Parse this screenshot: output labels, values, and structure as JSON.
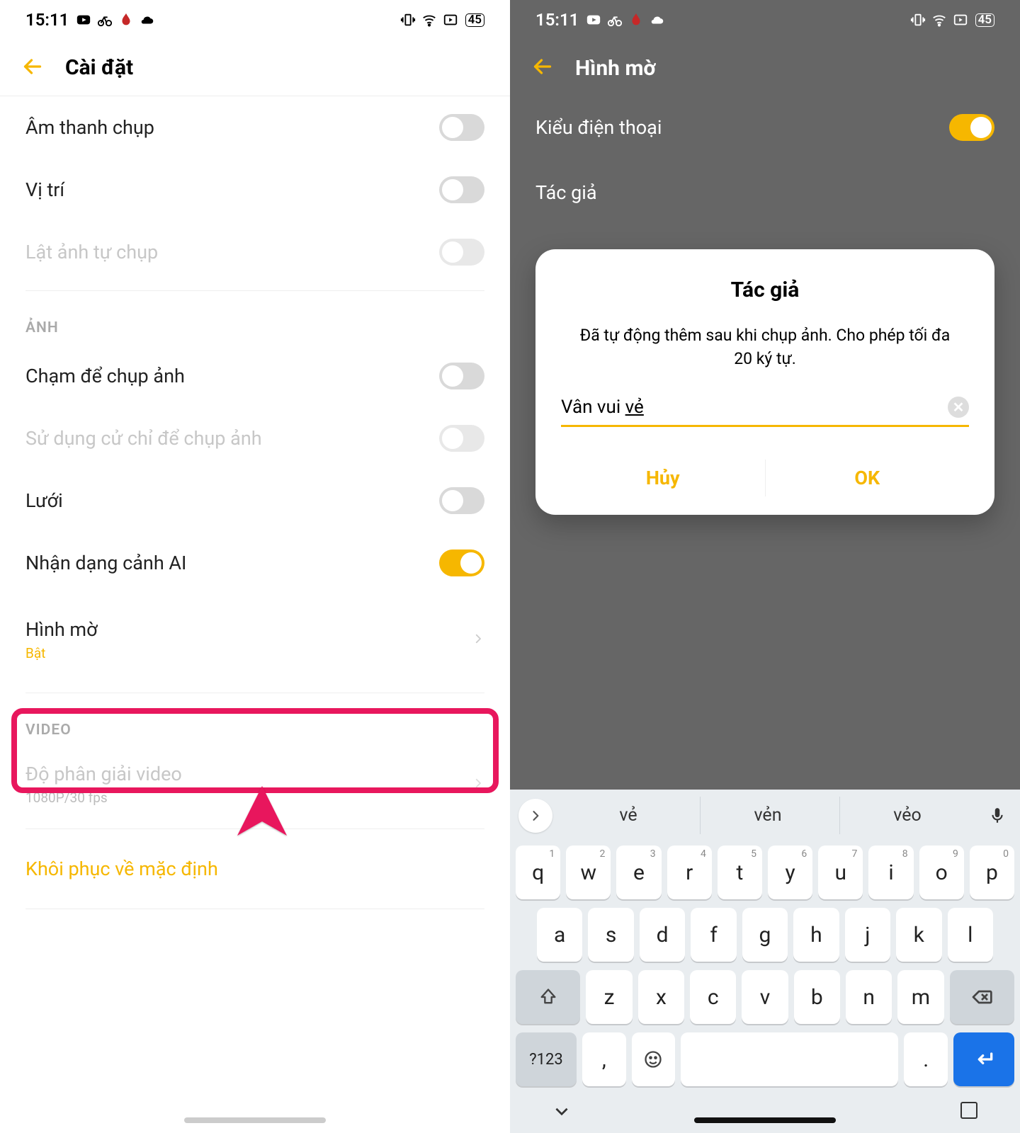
{
  "statusbar": {
    "time": "15:11",
    "battery": "45"
  },
  "left": {
    "header": "Cài đặt",
    "rows": {
      "shutterSound": "Âm thanh chụp",
      "location": "Vị trí",
      "mirrorSelfie": "Lật ảnh tự chụp",
      "sectionPhoto": "ẢNH",
      "tapToShoot": "Chạm để chụp ảnh",
      "gesture": "Sử dụng cử chỉ để chụp ảnh",
      "grid": "Lưới",
      "aiScene": "Nhận dạng cảnh AI",
      "watermark": "Hình mờ",
      "watermarkSub": "Bật",
      "sectionVideo": "VIDEO",
      "videoRes": "Độ phân giải video",
      "videoResSub": "1080P/30 fps",
      "reset": "Khôi phục về mặc định"
    }
  },
  "right": {
    "header": "Hình mờ",
    "deviceModel": "Kiểu điện thoại",
    "author": "Tác giả",
    "dialog": {
      "title": "Tác giả",
      "desc": "Đã tự động thêm sau khi chụp ảnh. Cho phép tối đa 20 ký tự.",
      "value_prefix": "Vân vui ",
      "value_suffix": "vẻ",
      "cancel": "Hủy",
      "ok": "OK"
    }
  },
  "keyboard": {
    "suggestions": [
      "vẻ",
      "vẻn",
      "vẻo"
    ],
    "row1": [
      {
        "k": "q",
        "n": "1"
      },
      {
        "k": "w",
        "n": "2"
      },
      {
        "k": "e",
        "n": "3"
      },
      {
        "k": "r",
        "n": "4"
      },
      {
        "k": "t",
        "n": "5"
      },
      {
        "k": "y",
        "n": "6"
      },
      {
        "k": "u",
        "n": "7"
      },
      {
        "k": "i",
        "n": "8"
      },
      {
        "k": "o",
        "n": "9"
      },
      {
        "k": "p",
        "n": "0"
      }
    ],
    "row2": [
      "a",
      "s",
      "d",
      "f",
      "g",
      "h",
      "j",
      "k",
      "l"
    ],
    "row3": [
      "z",
      "x",
      "c",
      "v",
      "b",
      "n",
      "m"
    ],
    "numKey": "?123",
    "comma": ",",
    "period": "."
  }
}
